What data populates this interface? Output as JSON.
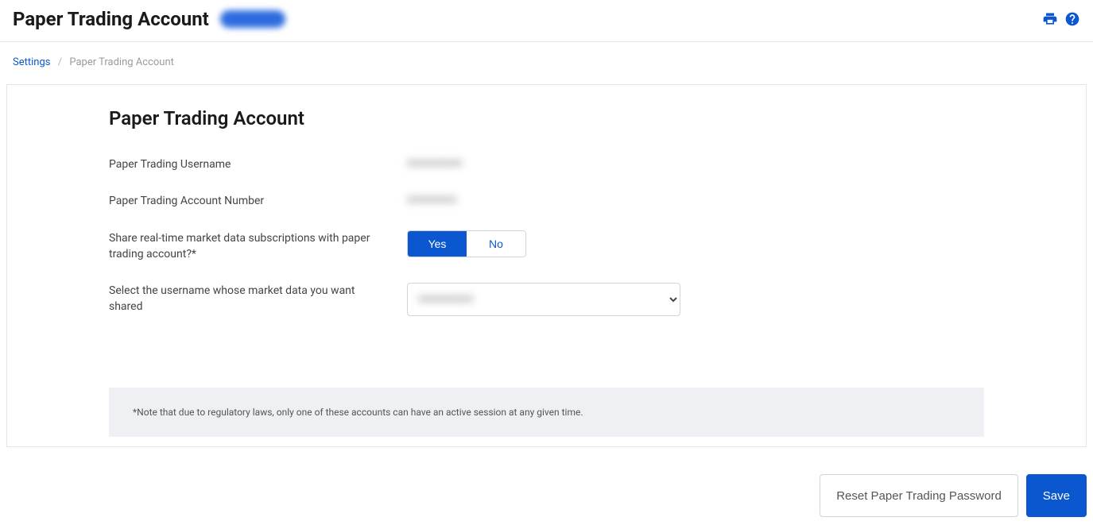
{
  "header": {
    "title": "Paper Trading Account",
    "badge_placeholder": "########"
  },
  "breadcrumb": {
    "root": "Settings",
    "current": "Paper Trading Account"
  },
  "panel": {
    "title": "Paper Trading Account",
    "username_label": "Paper Trading Username",
    "username_value": "xxxxxxxxxx",
    "account_number_label": "Paper Trading Account Number",
    "account_number_value": "xxxxxxxxx",
    "share_label": "Share real-time market data subscriptions with paper trading account?*",
    "toggle_yes": "Yes",
    "toggle_no": "No",
    "toggle_selected": "Yes",
    "select_label": "Select the username whose market data you want shared",
    "select_value": "xxxxxxxxxx",
    "note": "*Note that due to regulatory laws, only one of these accounts can have an active session at any given time."
  },
  "footer": {
    "reset": "Reset Paper Trading Password",
    "save": "Save"
  }
}
